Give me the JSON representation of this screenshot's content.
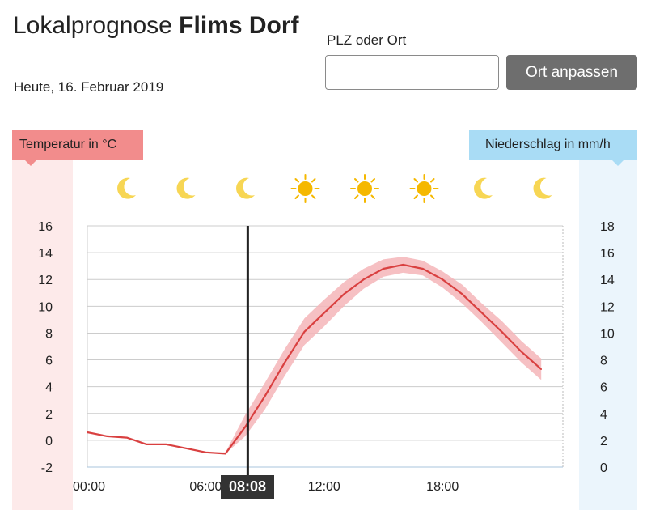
{
  "header": {
    "title_prefix": "Lokalprognose ",
    "title_location": "Flims Dorf",
    "date": "Heute, 16. Februar 2019"
  },
  "location": {
    "label": "PLZ oder Ort",
    "value": "",
    "placeholder": "",
    "button_label": "Ort anpassen"
  },
  "axis_tags": {
    "temperature": "Temperatur in °C",
    "precipitation": "Niederschlag in mm/h"
  },
  "weather_icons": [
    "moon-icon",
    "moon-icon",
    "moon-icon",
    "sun-icon",
    "sun-icon",
    "sun-icon",
    "moon-icon",
    "moon-icon"
  ],
  "now_marker": {
    "label": "08:08",
    "time_hours": 8.13
  },
  "colors": {
    "temp_line": "#d94040",
    "temp_band": "#f5b5b8",
    "temp_tag": "#f28c8c",
    "precip_tag": "#a9dcf5",
    "grid": "#cccccc",
    "sun": "#f5b800",
    "moon": "#f7d654",
    "now_line": "#222222"
  },
  "chart_data": {
    "type": "line",
    "x_unit": "hours",
    "xlim": [
      0,
      24
    ],
    "x_ticks": [
      0,
      6,
      12,
      18
    ],
    "x_tick_labels": [
      "00:00",
      "06:00",
      "12:00",
      "18:00"
    ],
    "y_left_ticks": [
      16,
      14,
      12,
      10,
      8,
      6,
      4,
      2,
      0,
      -2
    ],
    "y_left_range": [
      -2,
      16
    ],
    "y_right_ticks": [
      18,
      16,
      14,
      12,
      10,
      8,
      6,
      4,
      2,
      0
    ],
    "y_right_range": [
      0,
      18
    ],
    "grid": true,
    "series": [
      {
        "x": [
          0,
          1,
          2,
          3,
          4,
          5,
          6,
          7,
          8,
          9,
          10,
          11,
          12,
          13,
          14,
          15,
          16,
          17,
          18,
          19,
          20,
          21,
          22,
          23
        ],
        "y": [
          0.6,
          0.3,
          0.2,
          -0.3,
          -0.3,
          -0.6,
          -0.9,
          -1.0,
          1.0,
          3.3,
          5.8,
          8.1,
          9.5,
          10.9,
          12.0,
          12.8,
          13.1,
          12.8,
          12.0,
          10.9,
          9.5,
          8.1,
          6.6,
          5.3
        ],
        "y_low": [
          0.6,
          0.3,
          0.2,
          -0.3,
          -0.3,
          -0.6,
          -0.9,
          -1.0,
          0.3,
          2.3,
          4.8,
          7.1,
          8.5,
          10.0,
          11.3,
          12.2,
          12.5,
          12.3,
          11.4,
          10.2,
          8.8,
          7.3,
          5.8,
          4.5
        ],
        "y_high": [
          0.6,
          0.3,
          0.2,
          -0.3,
          -0.3,
          -0.6,
          -0.9,
          -0.9,
          1.9,
          4.3,
          6.8,
          9.1,
          10.5,
          11.8,
          12.8,
          13.5,
          13.7,
          13.4,
          12.6,
          11.6,
          10.2,
          8.9,
          7.4,
          6.1
        ]
      }
    ],
    "precipitation": []
  }
}
